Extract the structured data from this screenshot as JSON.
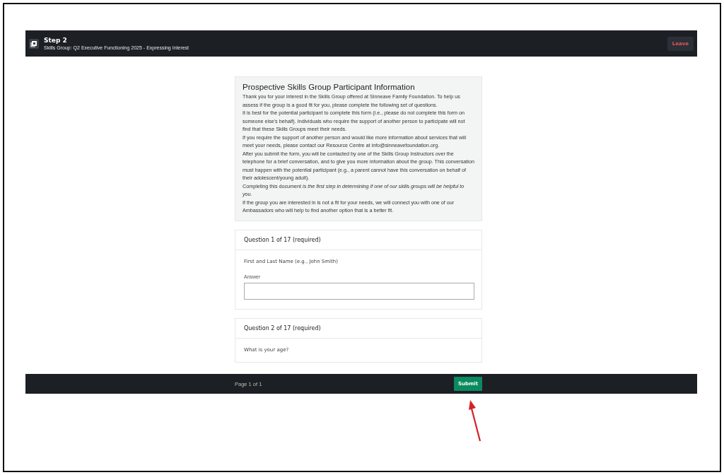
{
  "header": {
    "title": "Step 2",
    "subtitle": "Skills Group: Q2 Executive Functioning 2025 - Expressing Interest",
    "leave_button": "Leave"
  },
  "intro": {
    "title": "Prospective Skills Group Participant Information",
    "paragraphs": [
      "Thank you for your interest in the Skills Group offered at Sinneave Family Foundation. To help us assess if the group is a good fit for you, please complete the following set of questions.",
      "It is best for the potential participant to complete this form (i.e., please do not complete this form on someone else's behalf). Individuals who require the support of another person to participate will not find that these Skills Groups meet their needs.",
      "If you require the support of another person and would like more information about services that will meet your needs, please contact our Resource Centre at info@sinneavefoundation.org.",
      "After you submit the form, you will be contacted by one of the Skills Group Instructors over the telephone for a brief conversation, and to give you more information about the group. This conversation must happen with the potential participant (e.g., a parent cannot have this conversation on behalf of their adolescent/young adult).",
      "Completing this document *is the first step in determining if one of our skills groups will be helpful to you.*",
      "If the group you are interested in is not a fit for your needs, we will connect you with one of our Ambassadors who will help to find another option that is a better fit."
    ]
  },
  "questions": [
    {
      "heading": "Question 1 of 17 (required)",
      "prompt": "First and Last Name (e.g., John Smith)",
      "answer_label": "Answer"
    },
    {
      "heading": "Question 2 of 17 (required)",
      "prompt": "What is your age?"
    }
  ],
  "footer": {
    "page": "Page 1 of 1",
    "submit_button": "Submit"
  }
}
